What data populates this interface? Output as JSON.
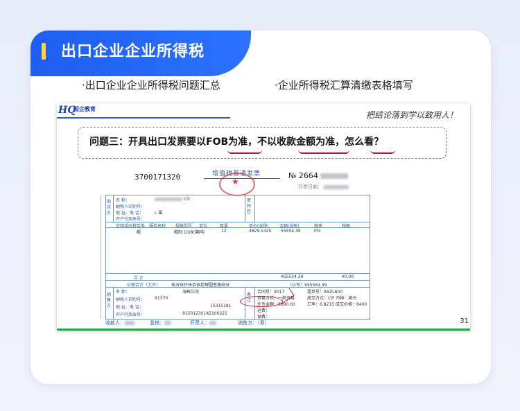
{
  "header": {
    "title": "出口企业企业所得税"
  },
  "subtopics": [
    "·出口企业企业所得税问题汇总",
    "·企业所得税汇算清缴表格填写"
  ],
  "slide": {
    "logo_mark": "HQ",
    "logo_text": "恒企教育",
    "motto": "把结论落到学以致用人！",
    "question": "问题三：开具出口发票要以FOB为准，不以收款金额为准，怎么看？",
    "page_number": "31"
  },
  "invoice": {
    "code": "3700171320",
    "title": "增值税普通发票",
    "number_prefix": "№ 2664",
    "date_label": "开票日期：",
    "buyer": {
      "label": "购买方",
      "fields": [
        "名        称：",
        "纳税人识别号：",
        "地 址、电 话：",
        "开户行及账号："
      ],
      "values": [
        "CO",
        "",
        "L 属",
        ""
      ]
    },
    "password_label": "密码区",
    "columns": [
      "货物或应税劳务、服务名称",
      "规格型号",
      "单位",
      "数量",
      "单价(含税)",
      "金额(含税)",
      "税率",
      "税额"
    ],
    "item": {
      "name": "鳕",
      "spec": "鳕制 10/80箱",
      "unit": "吨",
      "qty": "12",
      "price": "4629.5325",
      "amount": "55554.39",
      "rate": "0%",
      "tax": ""
    },
    "total_label": "合        计",
    "total_amount": "¥55554.39",
    "total_tax": "¥0.00",
    "tax_total_label": "价税合计（大写）",
    "tax_total_text": "伍万伍仟伍佰伍拾肆圆叁角玖分",
    "tax_total_small": "（小写）¥55554.39",
    "seller": {
      "label": "销售方",
      "fields": [
        "名        称：",
        "纳税人识别号：",
        "地 址、电 话：",
        "开户行及账号："
      ],
      "values": [
        "海鲜公司",
        "91370",
        "15315181",
        "81501230142100221"
      ]
    },
    "remarks": [
      "合同号：9017",
      "提单号：RAZL800",
      "贸易方式：一般贸易",
      "成交方式：CIF  币种：美元",
      "外币金额：8090.00",
      "汇率：6.8215  成交价格：8400",
      "运费：",
      "保费："
    ],
    "remarks_label": "备注",
    "footer": [
      "收款人：",
      "复核：",
      "开票人：",
      "销售方：（章）"
    ]
  }
}
